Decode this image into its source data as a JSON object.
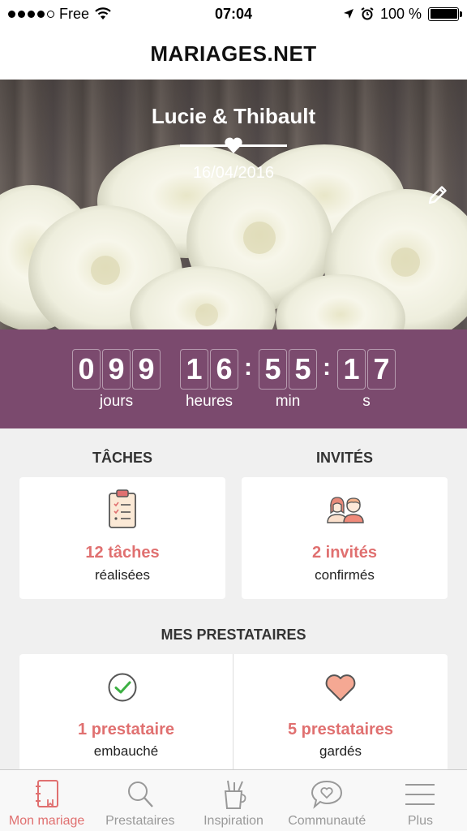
{
  "status_bar": {
    "carrier": "Free",
    "time": "07:04",
    "battery": "100 %"
  },
  "nav": {
    "title": "MARIAGES.NET"
  },
  "hero": {
    "couple": "Lucie & Thibault",
    "date": "16/04/2016",
    "edit_icon": "pencil-icon"
  },
  "countdown": {
    "days_digits": [
      "0",
      "9",
      "9"
    ],
    "hours_digits": [
      "1",
      "6"
    ],
    "minutes_digits": [
      "5",
      "5"
    ],
    "seconds_digits": [
      "1",
      "7"
    ],
    "labels": {
      "days": "jours",
      "hours": "heures",
      "minutes": "min",
      "seconds": "s"
    },
    "background": "#7b4a6e"
  },
  "tasks": {
    "title": "TÂCHES",
    "count": "12 tâches",
    "sub": "réalisées",
    "icon": "clipboard-icon"
  },
  "guests": {
    "title": "INVITÉS",
    "count": "2 invités",
    "sub": "confirmés",
    "icon": "couple-icon"
  },
  "vendors": {
    "title": "MES PRESTATAIRES",
    "hired": {
      "count": "1 prestataire",
      "sub": "embauché",
      "icon": "check-circle-icon"
    },
    "saved": {
      "count": "5 prestataires",
      "sub": "gardés",
      "icon": "heart-icon"
    }
  },
  "tabs": [
    {
      "label": "Mon mariage",
      "icon": "notebook-icon",
      "active": true
    },
    {
      "label": "Prestataires",
      "icon": "search-icon",
      "active": false
    },
    {
      "label": "Inspiration",
      "icon": "pencil-cup-icon",
      "active": false
    },
    {
      "label": "Communauté",
      "icon": "chat-heart-icon",
      "active": false
    },
    {
      "label": "Plus",
      "icon": "menu-icon",
      "active": false
    }
  ],
  "colors": {
    "accent": "#e07070",
    "countdown_bg": "#7b4a6e",
    "tab_inactive": "#999999"
  }
}
